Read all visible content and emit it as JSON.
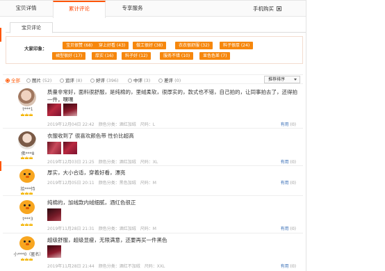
{
  "tabs": {
    "detail": "宝贝详情",
    "reviews": "累计评论",
    "service": "专享服务",
    "mobile_buy": "手机购买"
  },
  "subtab": "宝贝评论",
  "impressions": {
    "label": "大家印象：",
    "tags": [
      "宝贝很赞 (68)",
      "穿上好看 (43)",
      "做工很好 (38)",
      "衣衣很舒服 (32)",
      "料子很厚 (24)",
      "裙型很好 (17)",
      "厚实 (16)",
      "料子好 (12)",
      "服务不错 (10)",
      "显色色差 (7)"
    ]
  },
  "filters": {
    "items": [
      {
        "label": "全部",
        "count": ""
      },
      {
        "label": "图片",
        "count": "(52)"
      },
      {
        "label": "追评",
        "count": "(8)"
      },
      {
        "label": "好评",
        "count": "(396)"
      },
      {
        "label": "中评",
        "count": "(3)"
      },
      {
        "label": "差评",
        "count": "(0)"
      }
    ],
    "sort": "推荐排序"
  },
  "reviews": [
    {
      "nick": "t***1",
      "text": "质量非常好，面料很舒服，是纯棉的，里绒柔软，很厚实的，款式也不错，自己拍的，让同事拍去了，还得拍一件，嘿嘿",
      "date": "2019年12月04日 22:42",
      "color": "颜色分类：酒红加绒",
      "size": "尺码：L",
      "helpful": "有用",
      "helpful_count": "(0)"
    },
    {
      "nick": "佛***8",
      "text": "衣服收到了 很喜欢颜色带 性价比超高",
      "date": "2019年12月03日 21:25",
      "color": "颜色分类：酒红加绒",
      "size": "尺码：XL",
      "helpful": "有用",
      "helpful_count": "(0)"
    },
    {
      "nick": "拾***恃",
      "text": "厚实，大小合适，穿着好看，漂亮",
      "date": "2019年12月05日 20:11",
      "color": "颜色分类：黑色加绒",
      "size": "尺码：M",
      "helpful": "有用",
      "helpful_count": "(0)"
    },
    {
      "nick": "t***3",
      "text": "纯棉的，加绒款内绒细腻，酒红色很正",
      "date": "2019年11月28日 21:31",
      "color": "颜色分类：酒红加绒",
      "size": "尺码：M",
      "helpful": "有用",
      "helpful_count": "(0)"
    },
    {
      "nick": "小***0（匿名）",
      "text": "超级舒服，超级显瘦，无限满意，还要再买一件黑色",
      "date": "2019年11月28日 21:44",
      "color": "颜色分类：酒红不加绒",
      "size": "尺码：XXL",
      "helpful": "有用",
      "helpful_count": "(0)"
    }
  ],
  "colors": {
    "accent": "#ff5500",
    "tag_bg": "#f6870d",
    "link": "#3a6fb7"
  }
}
